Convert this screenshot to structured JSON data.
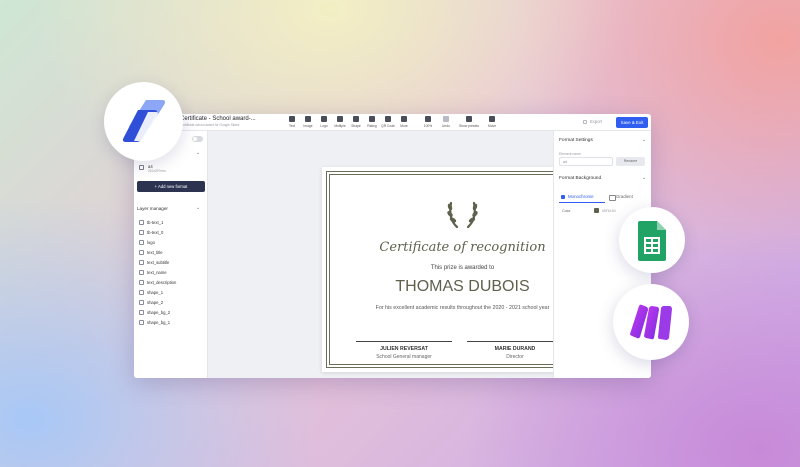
{
  "header": {
    "title": "Certificate - School award-...",
    "subtitle": "Certificate school award for Google Slides",
    "tools": [
      {
        "label": "Text",
        "icon": "text-icon"
      },
      {
        "label": "Image",
        "icon": "image-icon"
      },
      {
        "label": "Logo",
        "icon": "logo-icon"
      },
      {
        "label": "Multiple",
        "icon": "multiple-icon"
      },
      {
        "label": "Shape",
        "icon": "shape-icon"
      },
      {
        "label": "Rating",
        "icon": "rating-icon"
      },
      {
        "label": "QR Code",
        "icon": "qr-code-icon"
      },
      {
        "label": "More",
        "icon": "more-icon"
      }
    ],
    "tools2": [
      {
        "label": "100%",
        "icon": "zoom-icon"
      },
      {
        "label": "Undo",
        "icon": "undo-icon"
      },
      {
        "label": "Show presets",
        "icon": "presets-icon"
      },
      {
        "label": "Move",
        "icon": "move-icon"
      }
    ],
    "export_label": "Export",
    "save_label": "Save & Exit"
  },
  "left_panel": {
    "format": {
      "name": "a4",
      "size": "210x297mm"
    },
    "add_format_label": "+ Add new format",
    "layer_manager_title": "Layer manager",
    "layers": [
      "tb-text_1",
      "tb-text_0",
      "logo",
      "text_title",
      "text_subtitle",
      "text_name",
      "text_description",
      "shape_1",
      "shape_2",
      "shape_bg_2",
      "shape_bg_1"
    ]
  },
  "certificate": {
    "title": "Certificate of recognition",
    "prize_line": "This prize is awarded to",
    "recipient": "THOMAS DUBOIS",
    "description": "For his excellent academic results throughout the 2020 - 2021 school year",
    "signatures": [
      {
        "name": "JULIEN REVERSAT",
        "role": "School General manager"
      },
      {
        "name": "MARIE DURAND",
        "role": "Director"
      }
    ]
  },
  "right_panel": {
    "format_settings_title": "Format Settings",
    "element_name_label": "Element name",
    "element_name_value": "a4",
    "rename_label": "Rename",
    "format_background_title": "Format Background",
    "tab_monochrome": "Monochrome",
    "tab_gradient": "Gradient",
    "color_label": "Color",
    "color_hex": "#5F614D"
  },
  "colors": {
    "accent": "#2f5ef0",
    "certificate_olive": "#5f614d",
    "dark_button": "#2c3350"
  }
}
